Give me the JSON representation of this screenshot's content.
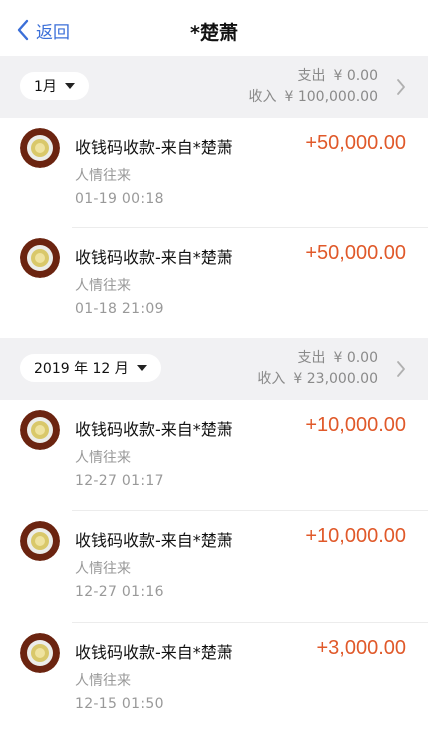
{
  "header": {
    "back_label": "返回",
    "title": "*楚萧"
  },
  "months": [
    {
      "month": "1月",
      "expense_label": "支出",
      "expense": "¥ 0.00",
      "income_label": "收入",
      "income": "¥ 100,000.00",
      "transactions": [
        {
          "title": "收钱码收款-来自*楚萧",
          "category": "人情往来",
          "time": "01-19  00:18",
          "amount": "+50,000.00"
        },
        {
          "title": "收钱码收款-来自*楚萧",
          "category": "人情往来",
          "time": "01-18  21:09",
          "amount": "+50,000.00"
        }
      ]
    },
    {
      "month": "2019 年 12 月",
      "expense_label": "支出",
      "expense": "¥ 0.00",
      "income_label": "收入",
      "income": "¥ 23,000.00",
      "transactions": [
        {
          "title": "收钱码收款-来自*楚萧",
          "category": "人情往来",
          "time": "12-27  01:17",
          "amount": "+10,000.00"
        },
        {
          "title": "收钱码收款-来自*楚萧",
          "category": "人情往来",
          "time": "12-27  01:16",
          "amount": "+10,000.00"
        },
        {
          "title": "收钱码收款-来自*楚萧",
          "category": "人情往来",
          "time": "12-15  01:50",
          "amount": "+3,000.00"
        }
      ]
    }
  ],
  "colors": {
    "accent": "#3b6fd8",
    "amount": "#e0592a",
    "section_bg": "#f1f1f3"
  }
}
